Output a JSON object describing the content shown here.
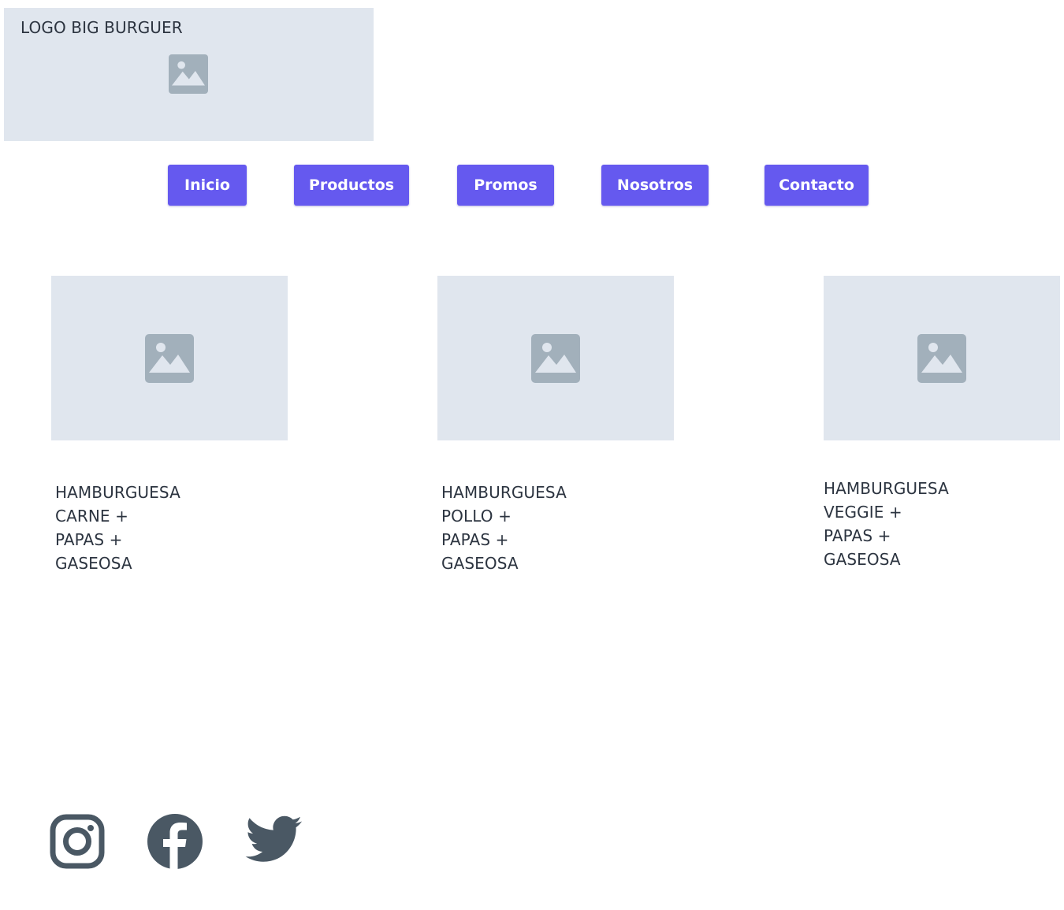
{
  "logo": {
    "text": "LOGO BIG BURGUER",
    "icon": "image-placeholder-icon"
  },
  "nav": {
    "items": [
      {
        "label": "Inicio"
      },
      {
        "label": "Productos"
      },
      {
        "label": "Promos"
      },
      {
        "label": "Nosotros"
      },
      {
        "label": "Contacto"
      }
    ]
  },
  "products": [
    {
      "lines": [
        "HAMBURGUESA",
        "CARNE +",
        "PAPAS +",
        "GASEOSA"
      ],
      "icon": "image-placeholder-icon"
    },
    {
      "lines": [
        "HAMBURGUESA",
        "POLLO +",
        "PAPAS +",
        "GASEOSA"
      ],
      "icon": "image-placeholder-icon"
    },
    {
      "lines": [
        "HAMBURGUESA",
        "VEGGIE +",
        "PAPAS +",
        "GASEOSA"
      ],
      "icon": "image-placeholder-icon"
    }
  ],
  "social": [
    {
      "icon": "instagram-icon"
    },
    {
      "icon": "facebook-icon"
    },
    {
      "icon": "twitter-icon"
    }
  ],
  "colors": {
    "button": "#6559ef",
    "placeholder_bg": "#e0e6ee",
    "placeholder_icon": "#a2b0bb",
    "text": "#2c3440",
    "social_icon": "#4a5864"
  }
}
